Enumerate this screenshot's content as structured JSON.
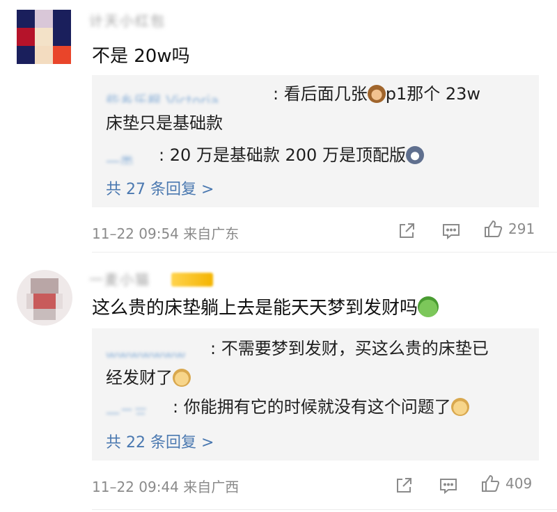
{
  "comments": [
    {
      "username": "计天小红包",
      "text": "不是 20w吗",
      "replies": [
        {
          "name": "些乡乐枫 Victoria",
          "text": "看后面几张",
          "text2": "p1那个 23w",
          "cont": "床垫只是基础款"
        },
        {
          "name": "一类",
          "text": "20 万是基础款 200 万是顶配版"
        }
      ],
      "more_replies": "共 27 条回复 >",
      "time": "11–22 09:54",
      "location": "来自广东",
      "likes": "291"
    },
    {
      "username": "一麦小猫",
      "text": "这么贵的床垫躺上去是能天天梦到发财吗",
      "replies": [
        {
          "name": "wwwwwww",
          "text": "不需要梦到发财，买这么贵的床垫已",
          "cont": "经发财了"
        },
        {
          "name": "一二三",
          "text": "你能拥有它的时候就没有这个问题了"
        }
      ],
      "more_replies": "共 22 条回复 >",
      "time": "11–22 09:44",
      "location": "来自广西",
      "likes": "409"
    }
  ],
  "icons": {
    "share": "share-icon",
    "comment": "comment-icon",
    "like": "thumbs-up-icon"
  }
}
